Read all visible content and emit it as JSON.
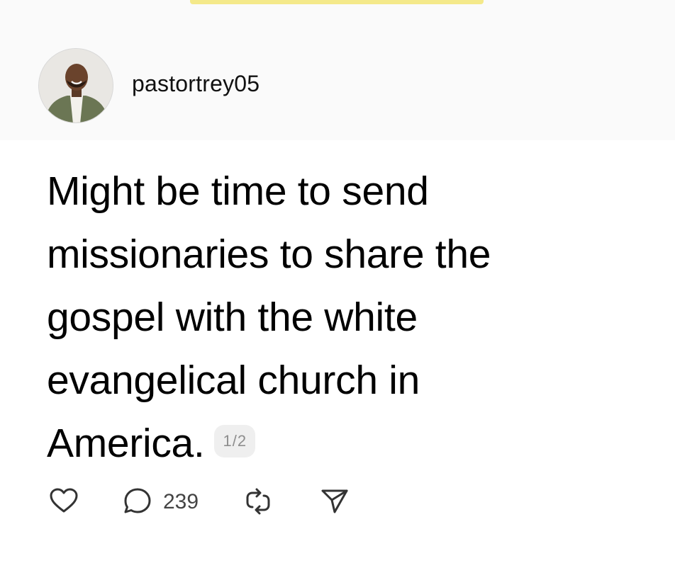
{
  "post": {
    "username": "pastortrey05",
    "text_lines": [
      "Might be time to send",
      "missionaries to share the",
      "gospel with the white",
      "evangelical church in",
      "America."
    ],
    "thread_badge": "1/2",
    "reply_count": "239"
  },
  "icons": {
    "like": "heart-icon",
    "reply": "speech-bubble-icon",
    "repost": "repost-arrows-icon",
    "share": "send-paper-plane-icon"
  },
  "colors": {
    "header_bg": "#fafafa",
    "text": "#000000",
    "icon": "#333333",
    "badge_bg": "#efefef",
    "badge_text": "#8e8e8e"
  }
}
